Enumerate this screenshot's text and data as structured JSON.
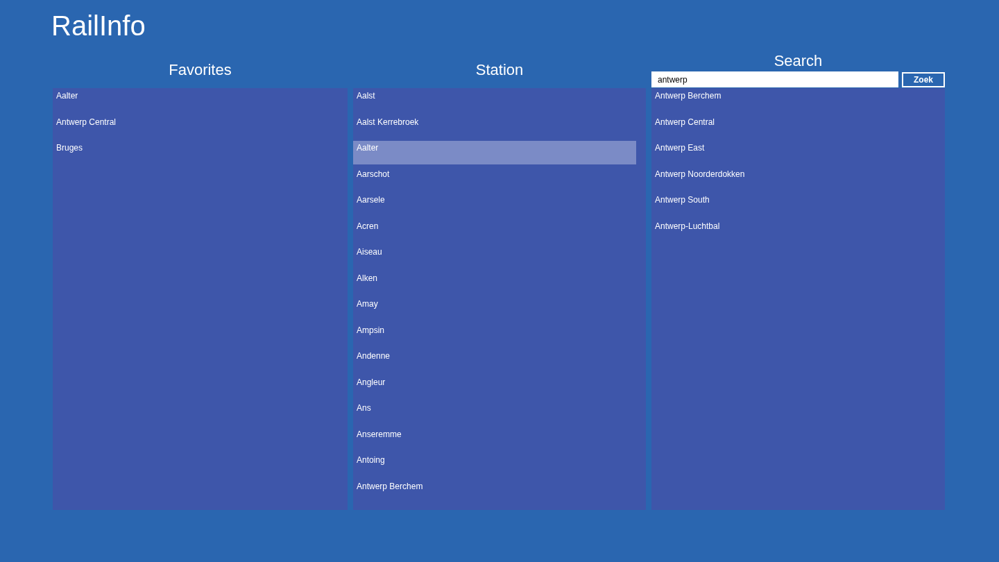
{
  "app": {
    "title": "RailInfo"
  },
  "favorites": {
    "heading": "Favorites",
    "items": [
      {
        "label": "Aalter",
        "selected": false
      },
      {
        "label": "Antwerp Central",
        "selected": false
      },
      {
        "label": "Bruges",
        "selected": false
      }
    ]
  },
  "station": {
    "heading": "Station",
    "items": [
      {
        "label": "Aalst",
        "selected": false
      },
      {
        "label": "Aalst Kerrebroek",
        "selected": false
      },
      {
        "label": "Aalter",
        "selected": true
      },
      {
        "label": "Aarschot",
        "selected": false
      },
      {
        "label": "Aarsele",
        "selected": false
      },
      {
        "label": "Acren",
        "selected": false
      },
      {
        "label": "Aiseau",
        "selected": false
      },
      {
        "label": "Alken",
        "selected": false
      },
      {
        "label": "Amay",
        "selected": false
      },
      {
        "label": "Ampsin",
        "selected": false
      },
      {
        "label": "Andenne",
        "selected": false
      },
      {
        "label": "Angleur",
        "selected": false
      },
      {
        "label": "Ans",
        "selected": false
      },
      {
        "label": "Anseremme",
        "selected": false
      },
      {
        "label": "Antoing",
        "selected": false
      },
      {
        "label": "Antwerp Berchem",
        "selected": false
      }
    ]
  },
  "search": {
    "heading": "Search",
    "query": "antwerp",
    "button": "Zoek",
    "results": [
      {
        "label": "Antwerp Berchem",
        "selected": false
      },
      {
        "label": "Antwerp Central",
        "selected": false
      },
      {
        "label": "Antwerp East",
        "selected": false
      },
      {
        "label": "Antwerp Noorderdokken",
        "selected": false
      },
      {
        "label": "Antwerp South",
        "selected": false
      },
      {
        "label": "Antwerp-Luchtbal",
        "selected": false
      }
    ]
  }
}
